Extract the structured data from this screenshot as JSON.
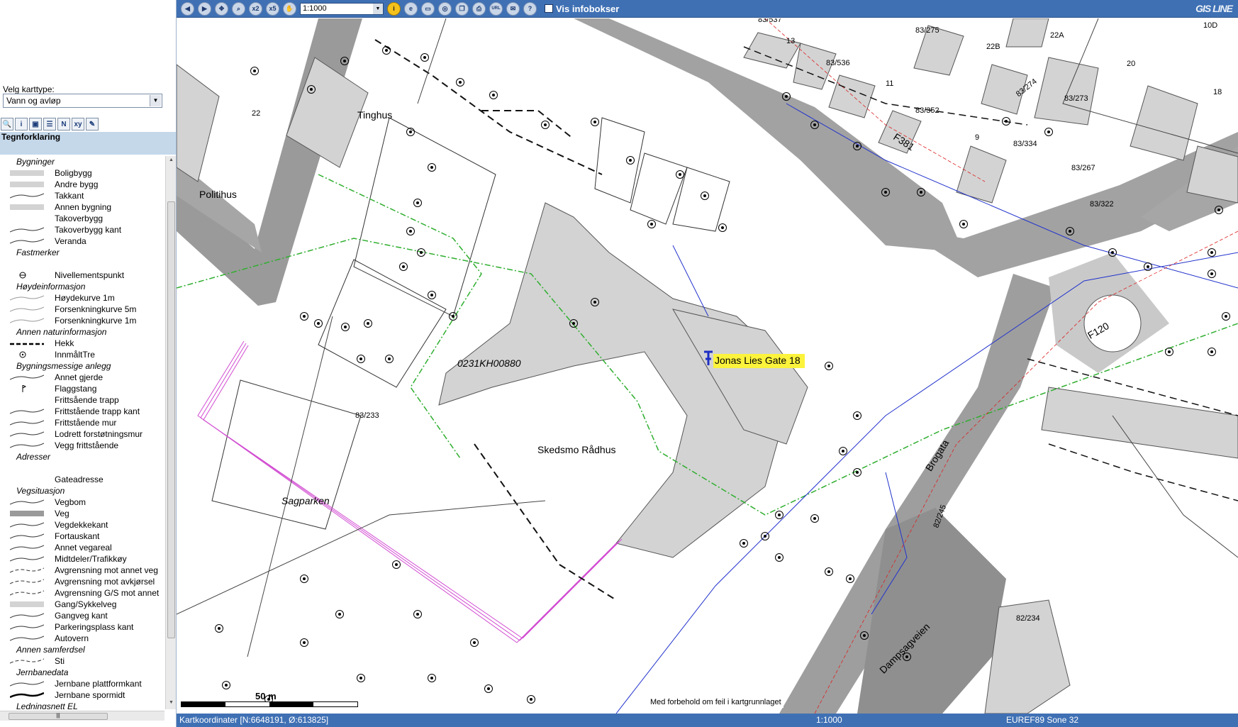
{
  "left_panel": {
    "karttype_label": "Velg karttype:",
    "karttype_value": "Vann og avløp",
    "tools": [
      "zoom-icon",
      "info-icon",
      "measure-icon",
      "layers-icon",
      "north-icon",
      "xy-icon",
      "edit-icon"
    ],
    "legend_title": "Tegnforklaring",
    "legend": [
      {
        "type": "group",
        "label": "Bygninger"
      },
      {
        "type": "item",
        "label": "Boligbygg",
        "sym": "fill"
      },
      {
        "type": "item",
        "label": "Andre bygg",
        "sym": "fill"
      },
      {
        "type": "item",
        "label": "Takkant",
        "sym": "line"
      },
      {
        "type": "item",
        "label": "Annen bygning",
        "sym": "fill"
      },
      {
        "type": "item",
        "label": "Takoverbygg",
        "sym": "none"
      },
      {
        "type": "item",
        "label": "Takoverbygg kant",
        "sym": "line"
      },
      {
        "type": "item",
        "label": "Veranda",
        "sym": "line"
      },
      {
        "type": "group",
        "label": "Fastmerker"
      },
      {
        "type": "item",
        "label": "",
        "sym": "none"
      },
      {
        "type": "item",
        "label": "Nivellementspunkt",
        "sym": "circle"
      },
      {
        "type": "group",
        "label": "Høydeinformasjon"
      },
      {
        "type": "item",
        "label": "Høydekurve 1m",
        "sym": "thin"
      },
      {
        "type": "item",
        "label": "Forsenkningkurve 5m",
        "sym": "thin"
      },
      {
        "type": "item",
        "label": "Forsenkningkurve 1m",
        "sym": "thin"
      },
      {
        "type": "group",
        "label": "Annen naturinformasjon"
      },
      {
        "type": "item",
        "label": "Hekk",
        "sym": "hedge"
      },
      {
        "type": "item",
        "label": "InnmåltTre",
        "sym": "tree"
      },
      {
        "type": "group",
        "label": "Bygningsmessige anlegg"
      },
      {
        "type": "item",
        "label": "Annet gjerde",
        "sym": "line"
      },
      {
        "type": "item",
        "label": "Flaggstang",
        "sym": "flag"
      },
      {
        "type": "item",
        "label": "Frittsående trapp",
        "sym": "none"
      },
      {
        "type": "item",
        "label": "Frittstående trapp kant",
        "sym": "line"
      },
      {
        "type": "item",
        "label": "Frittstående mur",
        "sym": "line"
      },
      {
        "type": "item",
        "label": "Lodrett forstøtningsmur",
        "sym": "line"
      },
      {
        "type": "item",
        "label": "Vegg frittstående",
        "sym": "line"
      },
      {
        "type": "group",
        "label": "Adresser"
      },
      {
        "type": "item",
        "label": "",
        "sym": "none"
      },
      {
        "type": "item",
        "label": "Gateadresse",
        "sym": "none"
      },
      {
        "type": "group",
        "label": "Vegsituasjon"
      },
      {
        "type": "item",
        "label": "Vegbom",
        "sym": "line"
      },
      {
        "type": "item",
        "label": "Veg",
        "sym": "dark"
      },
      {
        "type": "item",
        "label": "Vegdekkekant",
        "sym": "line"
      },
      {
        "type": "item",
        "label": "Fortauskant",
        "sym": "line"
      },
      {
        "type": "item",
        "label": "Annet vegareal",
        "sym": "line"
      },
      {
        "type": "item",
        "label": "Midtdeler/Trafikkøy",
        "sym": "line"
      },
      {
        "type": "item",
        "label": "Avgrensning mot annet veg",
        "sym": "dash"
      },
      {
        "type": "item",
        "label": "Avgrensning mot avkjørsel",
        "sym": "dash"
      },
      {
        "type": "item",
        "label": "Avgrensning G/S mot annet",
        "sym": "dash"
      },
      {
        "type": "item",
        "label": "Gang/Sykkelveg",
        "sym": "fill"
      },
      {
        "type": "item",
        "label": "Gangveg kant",
        "sym": "line"
      },
      {
        "type": "item",
        "label": "Parkeringsplass kant",
        "sym": "line"
      },
      {
        "type": "item",
        "label": "Autovern",
        "sym": "line"
      },
      {
        "type": "group",
        "label": "Annen samferdsel"
      },
      {
        "type": "item",
        "label": "Sti",
        "sym": "dash"
      },
      {
        "type": "group",
        "label": "Jernbanedata"
      },
      {
        "type": "item",
        "label": "Jernbane plattformkant",
        "sym": "line"
      },
      {
        "type": "item",
        "label": "Jernbane spormidt",
        "sym": "thick"
      },
      {
        "type": "group",
        "label": "Ledningsnett EL"
      }
    ]
  },
  "toolbar": {
    "icons": [
      "back-icon",
      "forward-icon",
      "pan-icon",
      "zoom-icon",
      "x2",
      "x5",
      "hand-icon"
    ],
    "scale_value": "1:1000",
    "right_icons": [
      "i",
      "e",
      "ruler-icon",
      "compass-icon",
      "copy-icon",
      "print-icon",
      "url-icon",
      "mail-icon",
      "help-icon"
    ],
    "infobox_label": "Vis infobokser",
    "logo": "GIS LINE"
  },
  "map": {
    "labels": [
      {
        "text": "Tinghus",
        "cls": "name"
      },
      {
        "text": "Politihus",
        "cls": "name"
      },
      {
        "text": "0231KH00880",
        "cls": "name"
      },
      {
        "text": "Skedsmo Rådhus",
        "cls": "name"
      },
      {
        "text": "Sagparken",
        "cls": "name"
      },
      {
        "text": "83/233",
        "cls": "small"
      },
      {
        "text": "83/537",
        "cls": "small"
      },
      {
        "text": "83/275",
        "cls": "small"
      },
      {
        "text": "83/536",
        "cls": "small"
      },
      {
        "text": "83/352",
        "cls": "small"
      },
      {
        "text": "83/274",
        "cls": "small"
      },
      {
        "text": "83/273",
        "cls": "small"
      },
      {
        "text": "83/334",
        "cls": "small"
      },
      {
        "text": "83/267",
        "cls": "small"
      },
      {
        "text": "83/322",
        "cls": "small"
      },
      {
        "text": "82/245",
        "cls": "small"
      },
      {
        "text": "82/234",
        "cls": "small"
      },
      {
        "text": "F381",
        "cls": "name"
      },
      {
        "text": "F120",
        "cls": "name"
      },
      {
        "text": "Brogata",
        "cls": "name"
      },
      {
        "text": "Dampsagveien",
        "cls": "name"
      },
      {
        "text": "13",
        "cls": "small"
      },
      {
        "text": "9",
        "cls": "small"
      },
      {
        "text": "11",
        "cls": "small"
      },
      {
        "text": "22",
        "cls": "small"
      },
      {
        "text": "22A",
        "cls": "small"
      },
      {
        "text": "22B",
        "cls": "small"
      },
      {
        "text": "20",
        "cls": "small"
      },
      {
        "text": "18",
        "cls": "small"
      },
      {
        "text": "10D",
        "cls": "small"
      }
    ],
    "address_pin": "Jonas Lies Gate 18",
    "scale_bar_label": "50 m",
    "disclaimer": "Med forbehold om feil i kartgrunnlaget"
  },
  "status": {
    "coords": "Kartkoordinater [N:6648191, Ø:613825]",
    "scale": "1:1000",
    "crs": "EUREF89 Sone 32"
  },
  "colors": {
    "toolbar_bg": "#3f70b4",
    "legend_header_bg": "#c5d8ea",
    "building_fill": "#d3d3d3",
    "road_fill": "#9a9a9a",
    "sewer_green": "#2fae2f",
    "water_blue": "#2233cc",
    "pink_line": "#d24cd2",
    "pin_label_bg": "#fbf33c"
  }
}
